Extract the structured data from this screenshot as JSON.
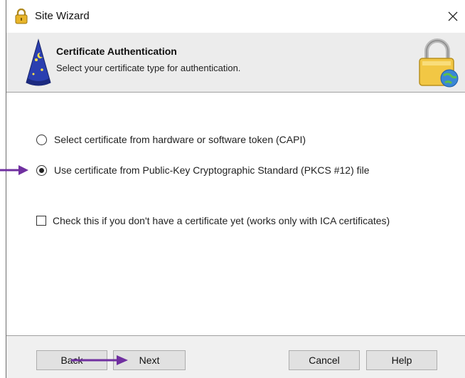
{
  "window": {
    "title": "Site Wizard"
  },
  "header": {
    "title": "Certificate Authentication",
    "subtitle": "Select your certificate type for authentication."
  },
  "options": [
    {
      "label": "Select certificate from hardware or software token (CAPI)",
      "checked": false
    },
    {
      "label": "Use certificate from Public-Key Cryptographic Standard (PKCS #12) file",
      "checked": true
    }
  ],
  "checkbox": {
    "label": "Check this if you don't have a certificate yet (works only with ICA certificates)",
    "checked": false
  },
  "buttons": {
    "back": "Back",
    "next": "Next",
    "cancel": "Cancel",
    "help": "Help"
  },
  "icons": {
    "title": "padlock-icon",
    "header_left": "wizard-hat-icon",
    "header_right": "padlock-globe-icon",
    "close": "close-icon"
  },
  "colors": {
    "annotation_arrow": "#7030a0",
    "header_band": "#ececec",
    "footer_band": "#f0f0f0"
  }
}
